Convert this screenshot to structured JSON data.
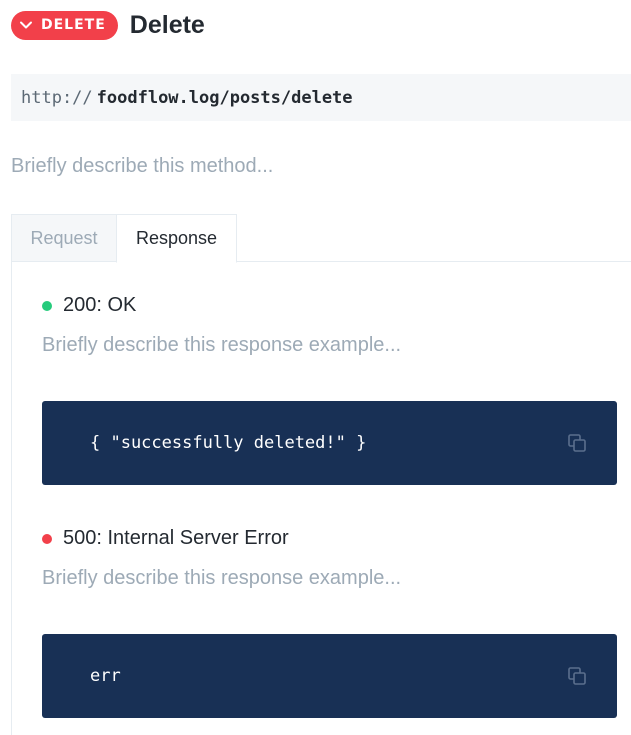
{
  "method": {
    "label": "DELETE",
    "title": "Delete",
    "color": "#f2404a"
  },
  "url": {
    "scheme": "http://",
    "path": "foodflow.log/posts/delete"
  },
  "method_description_placeholder": "Briefly describe this method...",
  "tabs": [
    {
      "label": "Request",
      "active": false
    },
    {
      "label": "Response",
      "active": true
    }
  ],
  "responses": [
    {
      "title": "200: OK",
      "status_color": "#26cb7c",
      "description_placeholder": "Briefly describe this response example...",
      "code": "{ \"successfully deleted!\" }"
    },
    {
      "title": "500: Internal Server Error",
      "status_color": "#f2404a",
      "description_placeholder": "Briefly describe this response example...",
      "code": "err"
    }
  ],
  "icons": {
    "method_chevron": "chevron-down-icon",
    "copy": "copy-icon"
  },
  "colors": {
    "code_background": "#183055",
    "placeholder": "#9daab6"
  }
}
